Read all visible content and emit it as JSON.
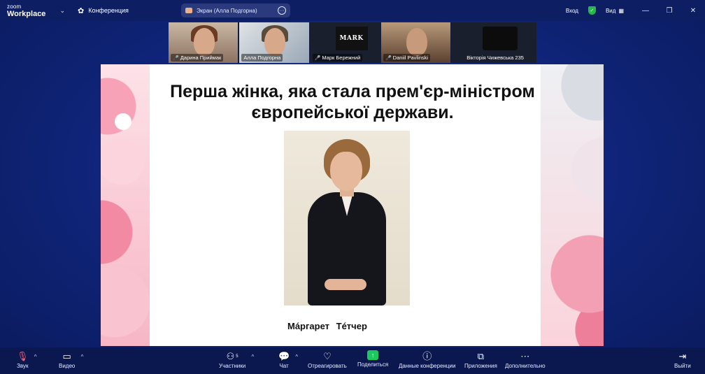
{
  "app": {
    "logo_small": "zoom",
    "logo_big": "Workplace",
    "meeting_label": "Конференция",
    "share_label": "Экран (Алла Подгорна)"
  },
  "titlebar_right": {
    "login": "Вход",
    "view": "Вид"
  },
  "participants": [
    {
      "name": "Дарина Приймак",
      "muted": true
    },
    {
      "name": "Алла Подгорна",
      "muted": false,
      "active": true
    },
    {
      "name": "Марк Бережний",
      "muted": true,
      "tile_text": "MARK"
    },
    {
      "name": "Daniil Pavlinski",
      "muted": true
    },
    {
      "name": "Вікторія Чижевська 235",
      "muted": false
    }
  ],
  "slide": {
    "title_line1": "Перша жінка, яка стала прем'єр-міністром",
    "title_line2": "європейської держави.",
    "caption": "Мáргарет Тéтчер"
  },
  "toolbar": {
    "audio": "Звук",
    "video": "Видео",
    "participants": "Участники",
    "participants_count": "5",
    "chat": "Чат",
    "react": "Отреагировать",
    "share": "Поделиться",
    "info": "Данные конференции",
    "apps": "Приложения",
    "more": "Дополнительно",
    "leave": "Выйти"
  },
  "colors": {
    "background": "#0f2478",
    "share_green": "#1ec75e",
    "active_outline": "#21c45e",
    "mute_red": "#ff4d4d"
  }
}
